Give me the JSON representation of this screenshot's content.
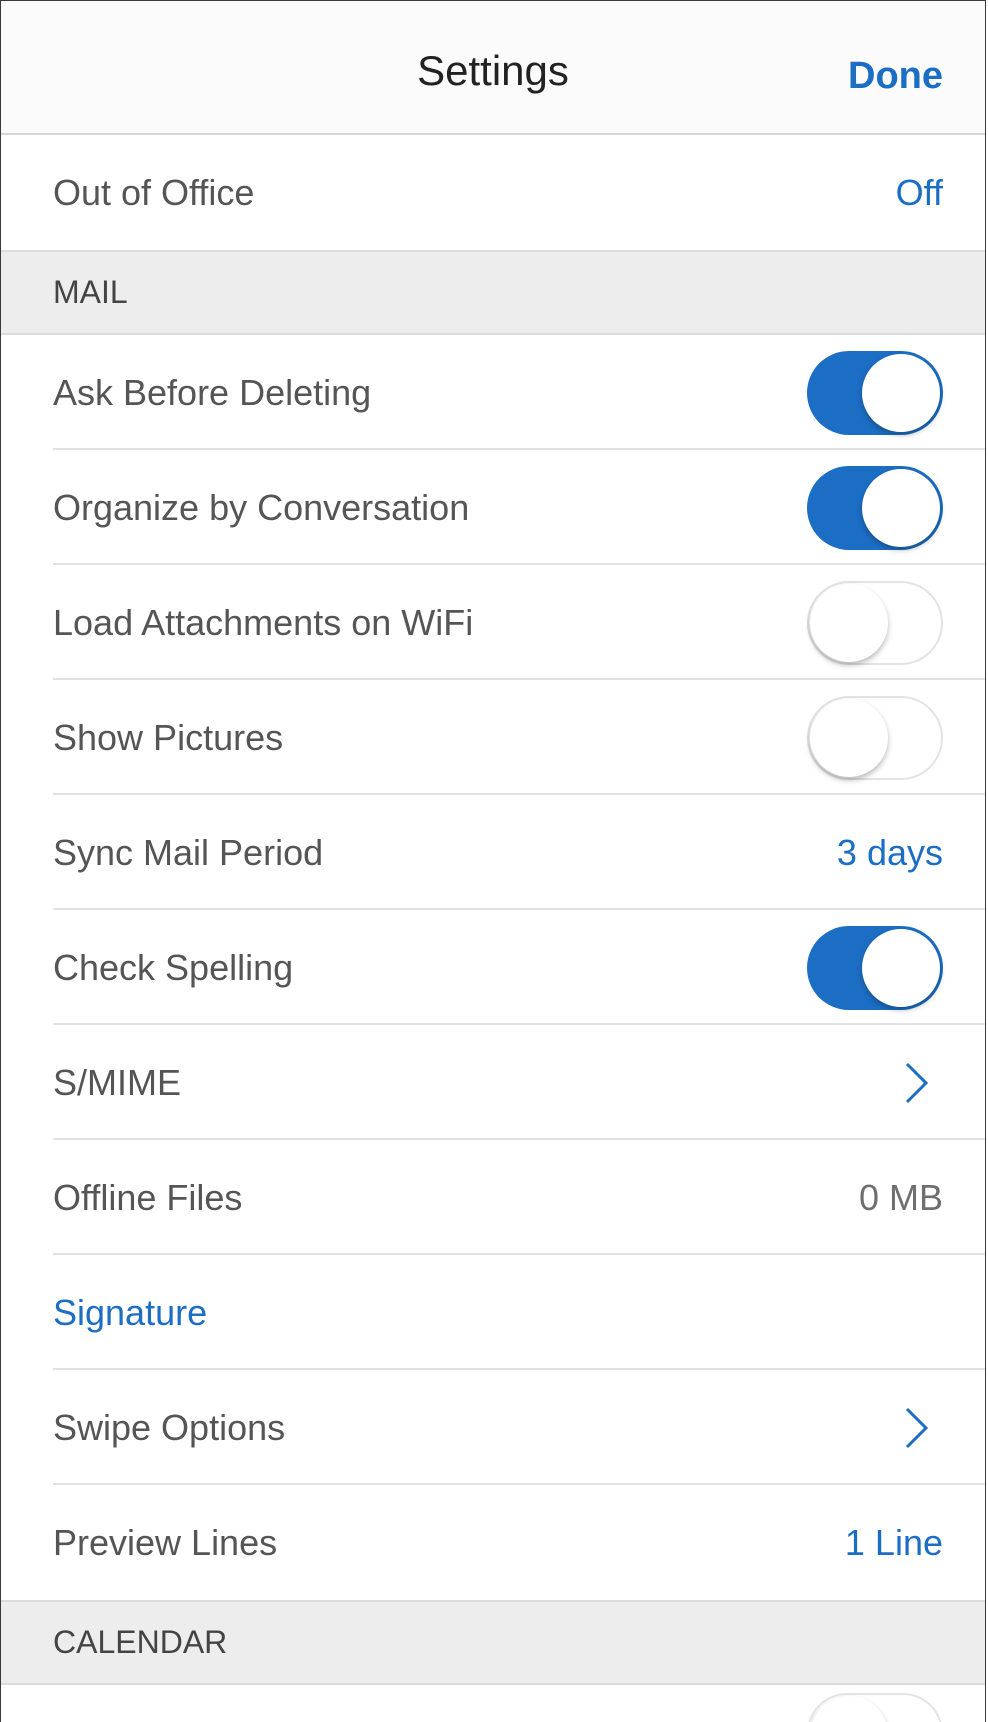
{
  "nav": {
    "title": "Settings",
    "done_label": "Done"
  },
  "top_rows": [
    {
      "label": "Out of Office",
      "value": "Off"
    }
  ],
  "sections": {
    "mail": "MAIL",
    "calendar": "CALENDAR"
  },
  "mail": {
    "ask_before_deleting": {
      "label": "Ask Before Deleting",
      "on": true
    },
    "organize_by_conversation": {
      "label": "Organize by Conversation",
      "on": true
    },
    "load_attachments_on_wifi": {
      "label": "Load Attachments on WiFi",
      "on": false
    },
    "show_pictures": {
      "label": "Show Pictures",
      "on": false
    },
    "sync_mail_period": {
      "label": "Sync Mail Period",
      "value": "3 days"
    },
    "check_spelling": {
      "label": "Check Spelling",
      "on": true
    },
    "smime": {
      "label": "S/MIME"
    },
    "offline_files": {
      "label": "Offline Files",
      "value": "0 MB"
    },
    "signature": {
      "label": "Signature"
    },
    "swipe_options": {
      "label": "Swipe Options"
    },
    "preview_lines": {
      "label": "Preview Lines",
      "value": "1 Line"
    }
  },
  "colors": {
    "accent": "#1c6ec4",
    "section_bg": "#ededed",
    "text": "#555555"
  },
  "icons": {
    "chevron": "chevron-right-icon"
  }
}
